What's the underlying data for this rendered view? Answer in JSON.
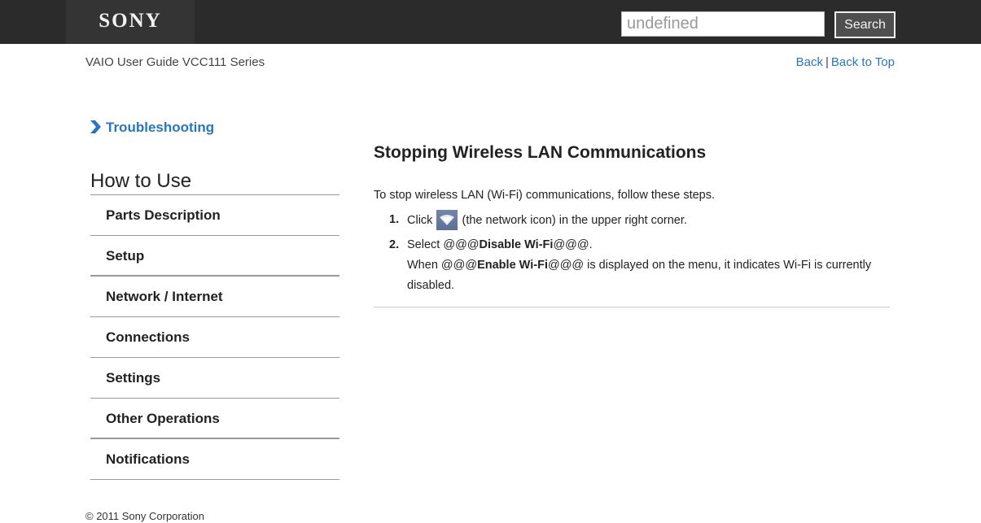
{
  "header": {
    "brand": "SONY",
    "search": {
      "placeholder": "undefined",
      "value": "",
      "button_label": "Search"
    }
  },
  "subheader": {
    "guide_title": "VAIO User Guide VCC111 Series",
    "nav": {
      "back": "Back",
      "separator": "|",
      "back_to_top": "Back to Top"
    }
  },
  "sidebar": {
    "breadcrumb": {
      "icon": "chevron-right-icon",
      "label": "Troubleshooting",
      "color": "#2a76be"
    },
    "section_title": "How to Use",
    "items": [
      {
        "label": "Parts Description"
      },
      {
        "label": "Setup"
      },
      {
        "label": "Network / Internet"
      },
      {
        "label": "Connections"
      },
      {
        "label": "Settings"
      },
      {
        "label": "Other Operations"
      },
      {
        "label": "Notifications"
      }
    ]
  },
  "article": {
    "title": "Stopping Wireless LAN Communications",
    "intro": "To stop wireless LAN (Wi-Fi) communications, follow these steps.",
    "steps": [
      {
        "number": "1.",
        "pre": "Click",
        "icon": "wifi-network-icon",
        "post": "(the network icon) in the upper right corner."
      },
      {
        "number": "2.",
        "pre": "Select",
        "bold_open": "@@@",
        "bold": "Disable Wi-Fi",
        "bold_close": "@@@",
        "end": ".",
        "note_pre": "When",
        "note_open": "@@@",
        "note_bold": "Enable Wi-Fi",
        "note_close": "@@@",
        "note_post": "is displayed on the menu, it indicates Wi-Fi is currently disabled."
      }
    ]
  },
  "footer": {
    "copyright": "© 2011 Sony Corporation"
  },
  "colors": {
    "topbar": "#2c2b2b",
    "link": "#2a76be",
    "text": "#222222"
  }
}
